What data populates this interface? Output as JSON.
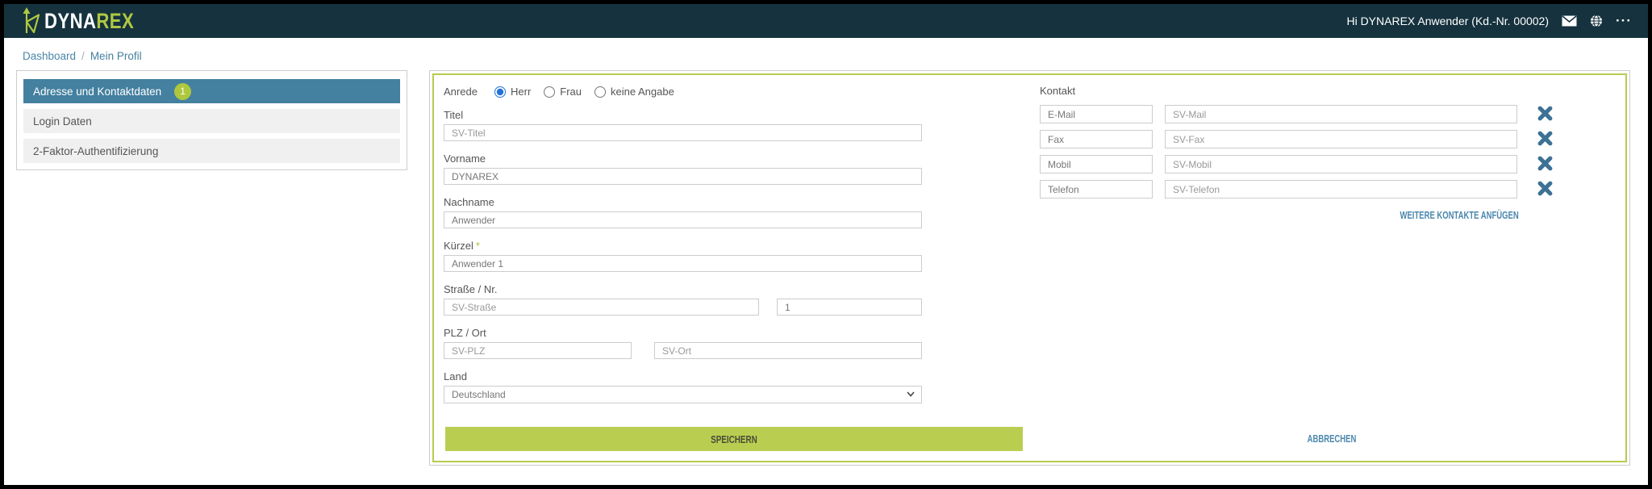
{
  "header": {
    "logo": {
      "text_primary": "DYNA",
      "text_accent": "REX",
      "icon": "dynarex-logo-icon"
    },
    "user_greeting": "Hi DYNAREX Anwender (Kd.-Nr. 00002)",
    "more_glyph": "···"
  },
  "breadcrumb": {
    "link": "Dashboard",
    "separator": "/",
    "current": "Mein Profil"
  },
  "sidebar": {
    "items": [
      {
        "label": "Adresse und Kontaktdaten",
        "badge": "1",
        "active": true
      },
      {
        "label": "Login Daten"
      },
      {
        "label": "2-Faktor-Authentifizierung"
      }
    ]
  },
  "form": {
    "anrede": {
      "label": "Anrede",
      "options": [
        {
          "label": "Herr",
          "checked_attr": "checked"
        },
        {
          "label": "Frau"
        },
        {
          "label": "keine Angabe"
        }
      ]
    },
    "fields": {
      "titel": {
        "label": "Titel",
        "placeholder": "SV-Titel"
      },
      "vorname": {
        "label": "Vorname",
        "value": "DYNAREX"
      },
      "nachname": {
        "label": "Nachname",
        "value": "Anwender"
      },
      "kuerzel": {
        "label": "Kürzel",
        "required_mark": "*",
        "value": "Anwender 1"
      },
      "strasse": {
        "label": "Straße / Nr.",
        "strasse_placeholder": "SV-Straße",
        "nr_value": "1"
      },
      "plz_ort": {
        "label": "PLZ / Ort",
        "plz_placeholder": "SV-PLZ",
        "ort_placeholder": "SV-Ort"
      },
      "land": {
        "label": "Land",
        "value": "Deutschland"
      }
    },
    "kontakt": {
      "label": "Kontakt",
      "rows": [
        {
          "type": "E-Mail",
          "placeholder": "SV-Mail"
        },
        {
          "type": "Fax",
          "placeholder": "SV-Fax"
        },
        {
          "type": "Mobil",
          "placeholder": "SV-Mobil"
        },
        {
          "type": "Telefon",
          "placeholder": "SV-Telefon"
        }
      ],
      "add_link": "WEITERE KONTAKTE ANFÜGEN"
    },
    "actions": {
      "save": "SPEICHERN",
      "cancel": "ABBRECHEN"
    }
  },
  "colors": {
    "header_bg": "#15323e",
    "accent_lime": "#b0c742",
    "button_lime": "#b9ce51",
    "panel_border_lime": "#b5cc4e",
    "active_item_blue": "#44809f",
    "link_blue": "#4c87ad",
    "remove_x_blue": "#3d7195",
    "input_border": "#cccccc"
  },
  "icons": {
    "logo": "dynarex-logo-icon",
    "mail": "mail-icon",
    "globe": "globe-icon",
    "more": "more-icon",
    "close": "close-icon",
    "chevron": "chevron-down-icon"
  }
}
